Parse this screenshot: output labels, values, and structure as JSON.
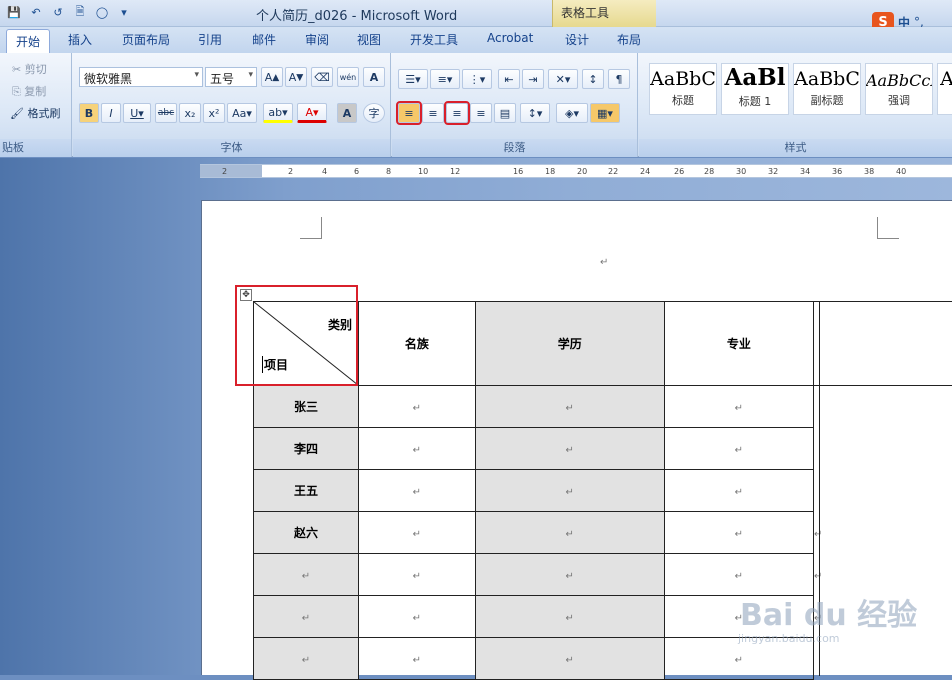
{
  "window": {
    "title": "个人简历_d026 - Microsoft Word",
    "context_tab": "表格工具",
    "ime_label": "中"
  },
  "tabs": [
    "开始",
    "插入",
    "页面布局",
    "引用",
    "邮件",
    "审阅",
    "视图",
    "开发工具",
    "Acrobat",
    "设计",
    "布局"
  ],
  "clipboard": {
    "cut": "剪切",
    "copy": "复制",
    "format_painter": "格式刷",
    "group_label": "贴板"
  },
  "font": {
    "name": "微软雅黑",
    "size": "五号",
    "group_label": "字体",
    "phonetic": "wén"
  },
  "paragraph": {
    "group_label": "段落"
  },
  "styles": {
    "group_label": "样式",
    "items": [
      {
        "sample": "AaBbC",
        "name": "标题"
      },
      {
        "sample": "AaBl",
        "name": "标题 1"
      },
      {
        "sample": "AaBbC",
        "name": "副标题"
      },
      {
        "sample": "AaBbCcI",
        "name": "强调"
      }
    ]
  },
  "ruler": [
    "2",
    "2",
    "4",
    "6",
    "8",
    "10",
    "12",
    "16",
    "18",
    "20",
    "22",
    "24",
    "26",
    "28",
    "30",
    "32",
    "34",
    "36",
    "38",
    "40"
  ],
  "table": {
    "diag_top": "类别",
    "diag_bottom": "项目",
    "headers": [
      "名族",
      "学历",
      "专业"
    ],
    "rows": [
      "张三",
      "李四",
      "王五",
      "赵六"
    ],
    "empty_mark": "↵"
  },
  "watermark": {
    "brand": "Bai du 经验",
    "url": "jingyan.baidu.com"
  }
}
